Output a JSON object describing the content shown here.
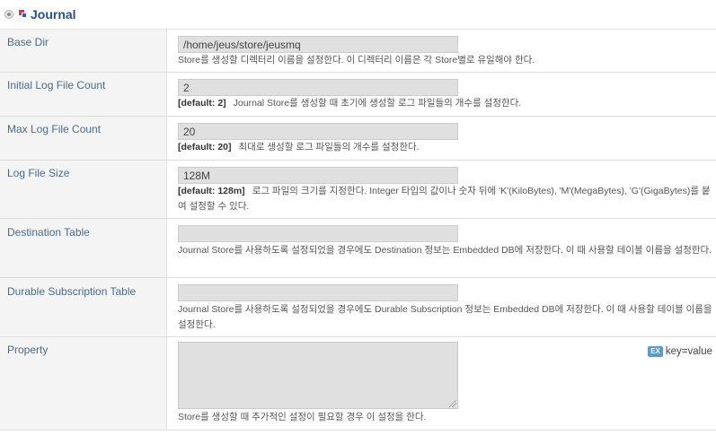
{
  "section": {
    "title": "Journal"
  },
  "fields": {
    "base_dir": {
      "label": "Base Dir",
      "value": "/home/jeus/store/jeusmq",
      "description": "Store를 생성할 디렉터리 이름을 설정한다. 이 디렉터리 이름은 각 Store별로 유일해야 한다."
    },
    "initial_log_file_count": {
      "label": "Initial Log File Count",
      "value": "2",
      "default": "[default: 2]",
      "description": "Journal Store를 생성할 때 초기에 생성할 로그 파일들의 개수를 설정한다."
    },
    "max_log_file_count": {
      "label": "Max Log File Count",
      "value": "20",
      "default": "[default: 20]",
      "description": "최대로 생성할 로그 파일들의 개수를 설정한다."
    },
    "log_file_size": {
      "label": "Log File Size",
      "value": "128M",
      "default": "[default: 128m]",
      "description": "로그 파일의 크기를 지정한다. Integer 타입의 값이나 숫자 뒤에 'K'(KiloBytes), 'M'(MegaBytes), 'G'(GigaBytes)를 붙여 설정할 수 있다."
    },
    "destination_table": {
      "label": "Destination Table",
      "value": "",
      "description": "Journal Store를 사용하도록 설정되었을 경우에도 Destination 정보는 Embedded DB에 저장한다. 이 때 사용할 테이블 이름을 설정한다."
    },
    "durable_subscription_table": {
      "label": "Durable Subscription Table",
      "value": "",
      "description": "Journal Store를 사용하도록 설정되었을 경우에도 Durable Subscription 정보는 Embedded DB에 저장한다. 이 때 사용할 테이블 이름을 설정한다."
    },
    "property": {
      "label": "Property",
      "value": "",
      "example_badge": "EX",
      "example_text": "key=value",
      "description": "Store를 생성할 때 추가적인 설정이 필요할 경우 이 설정을 한다."
    }
  }
}
